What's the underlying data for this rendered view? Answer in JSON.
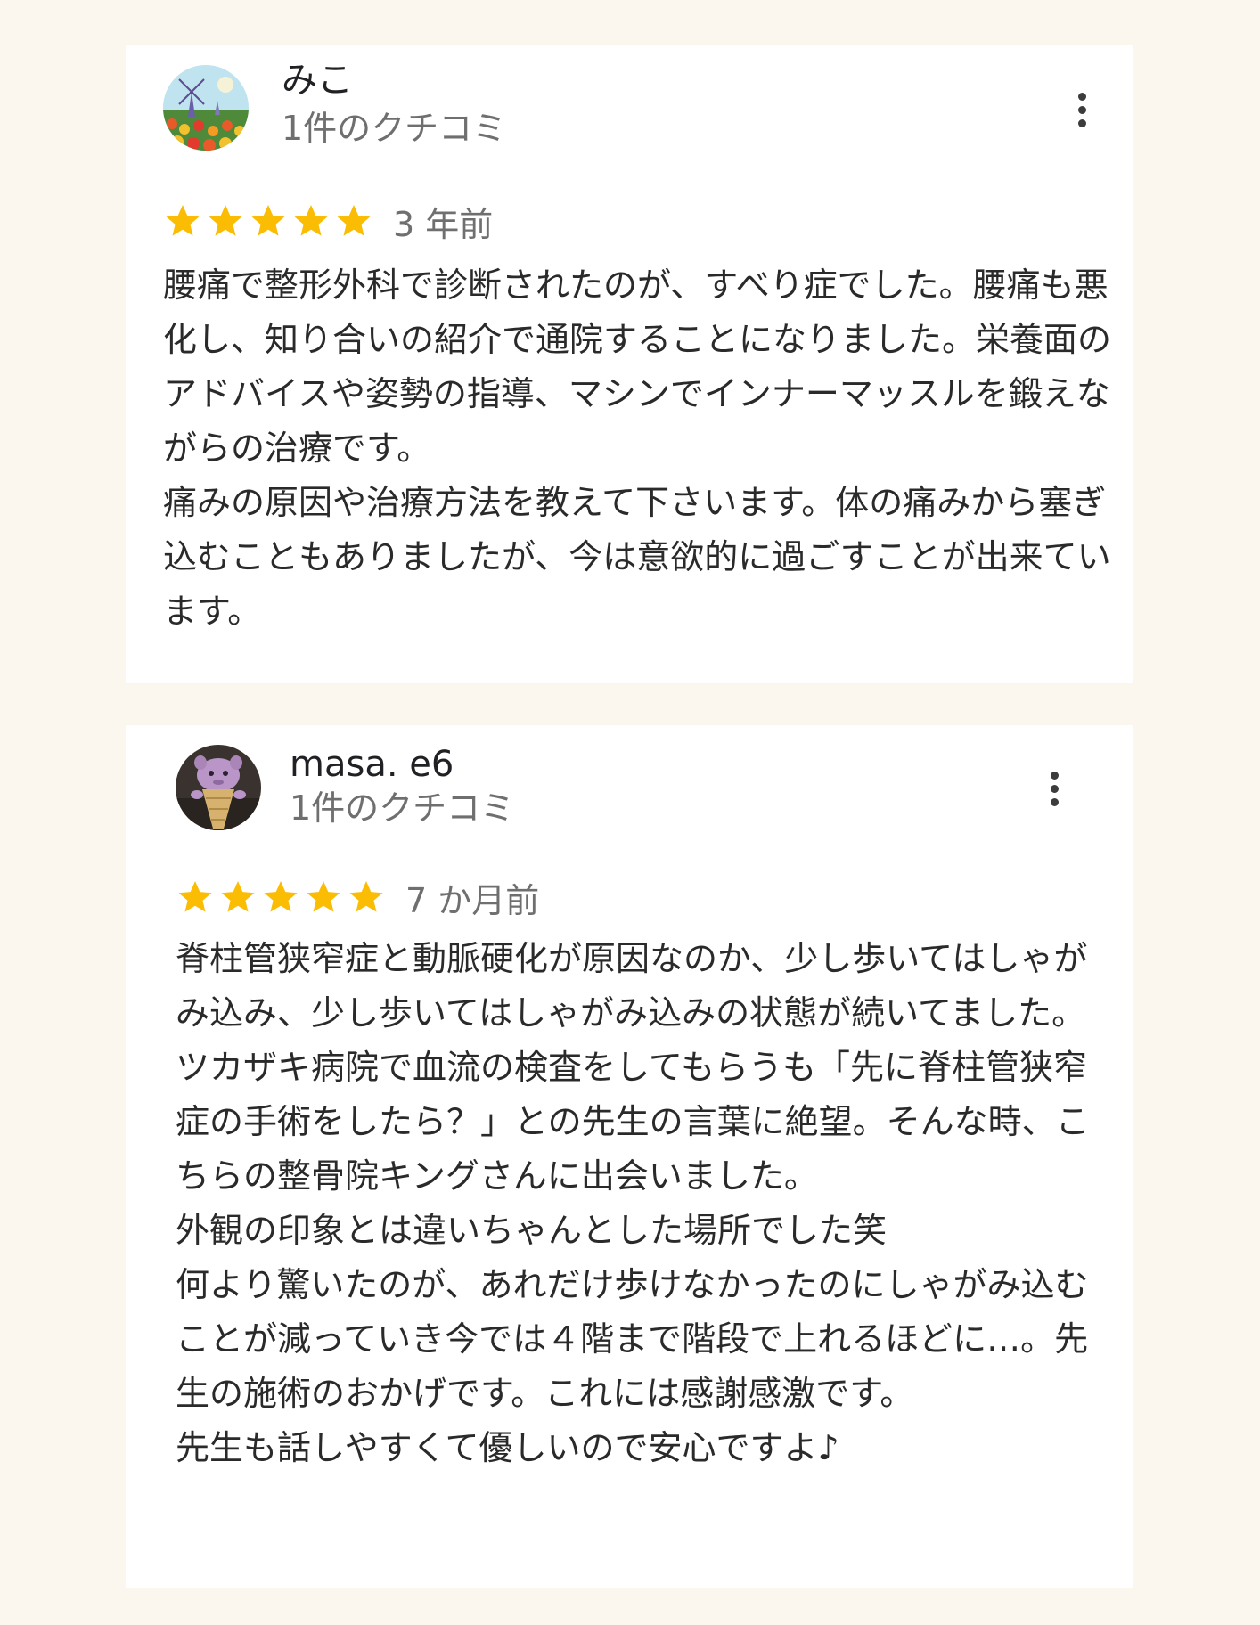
{
  "colors": {
    "background": "#fbf7ef",
    "card": "#ffffff",
    "star": "#fbbc04",
    "meta_text": "#6f6f6f"
  },
  "reviews": [
    {
      "author": "みこ",
      "review_count": "1件のクチコミ",
      "rating": 5,
      "time_ago": "3 年前",
      "avatar_icon": "windmill-tulip-field-avatar",
      "menu_icon": "more-vert-icon",
      "text": "腰痛で整形外科で診断されたのが、すべり症でした。腰痛も悪化し、知り合いの紹介で通院することになりました。栄養面のアドバイスや姿勢の指導、マシンでインナーマッスルを鍛えながらの治療です。\n痛みの原因や治療方法を教えて下さいます。体の痛みから塞ぎ込むこともありましたが、今は意欲的に過ごすことが出来ています。"
    },
    {
      "author": "masa. e6",
      "review_count": "1件のクチコミ",
      "rating": 5,
      "time_ago": "7 か月前",
      "avatar_icon": "plush-toy-avatar",
      "menu_icon": "more-vert-icon",
      "text": "脊柱管狭窄症と動脈硬化が原因なのか、少し歩いてはしゃがみ込み、少し歩いてはしゃがみ込みの状態が続いてました。\nツカザキ病院で血流の検査をしてもらうも「先に脊柱管狭窄症の手術をしたら？」との先生の言葉に絶望。そんな時、こちらの整骨院キングさんに出会いました。\n外観の印象とは違いちゃんとした場所でした笑\n何より驚いたのが、あれだけ歩けなかったのにしゃがみ込むことが減っていき今では４階まで階段で上れるほどに…。先生の施術のおかげです。これには感謝感激です。\n先生も話しやすくて優しいので安心ですよ♪"
    }
  ]
}
